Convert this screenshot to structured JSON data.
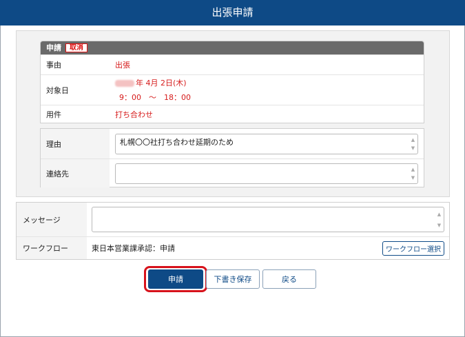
{
  "header": {
    "title": "出張申請"
  },
  "application": {
    "header_label": "申請",
    "cancel_badge": "取消",
    "rows": [
      {
        "label": "事由",
        "value": "出張"
      },
      {
        "label": "対象日",
        "date": "年 4月 2日(木)",
        "time": "9：00　～　18：00"
      },
      {
        "label": "用件",
        "value": "打ち合わせ"
      }
    ]
  },
  "form": {
    "reason_label": "理由",
    "reason_value": "札幌〇〇社打ち合わせ延期のため",
    "contact_label": "連絡先",
    "contact_value": ""
  },
  "workflow_panel": {
    "message_label": "メッセージ",
    "message_value": "",
    "workflow_label": "ワークフロー",
    "workflow_value": "東日本営業課承認：申請",
    "workflow_select_button": "ワークフロー選択"
  },
  "actions": {
    "submit": "申請",
    "save_draft": "下書き保存",
    "back": "戻る"
  },
  "colors": {
    "header_bg": "#0e4a86",
    "value_red": "#d61a1a",
    "highlight": "#d7121b"
  }
}
